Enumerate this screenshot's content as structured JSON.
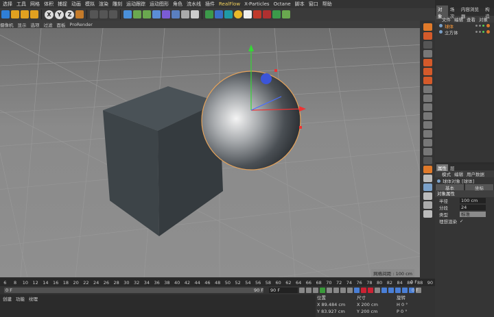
{
  "menubar": {
    "items": [
      "选择",
      "工具",
      "网格",
      "体积",
      "捕捉",
      "动画",
      "模拟",
      "渲染",
      "雕刻",
      "运动跟踪",
      "运动图形",
      "角色",
      "流水线",
      "插件",
      "RealFlow",
      "X-Particles",
      "Octane",
      "脚本",
      "窗口",
      "帮助"
    ]
  },
  "toolbar": {
    "axis_x": "X",
    "axis_y": "Y",
    "axis_z": "Z"
  },
  "viewport_menu": {
    "items": [
      "摄像机",
      "显示",
      "选项",
      "过滤",
      "面板",
      "ProRender"
    ],
    "grid_footer": "网格间距 : 100 cm"
  },
  "object_manager": {
    "tabs": [
      "对象",
      "场次",
      "内容浏览器",
      "构造"
    ],
    "menu": [
      "文件",
      "编辑",
      "查看",
      "对象"
    ],
    "objects": [
      {
        "name": "球体",
        "selected": true
      },
      {
        "name": "立方体",
        "selected": false
      }
    ]
  },
  "attributes": {
    "tabs": [
      "属性",
      "层"
    ],
    "menu": [
      "模式",
      "编辑",
      "用户数据"
    ],
    "object_title": "球体对象 [球体]",
    "subtabs": [
      "基本",
      "坐标"
    ],
    "section": "对象属性",
    "props": [
      {
        "label": "半径",
        "value": "100 cm",
        "highlight": false
      },
      {
        "label": "分段",
        "value": "24",
        "highlight": false
      },
      {
        "label": "类型",
        "value": "标准",
        "highlight": true
      },
      {
        "label": "理想渲染",
        "value": "✓",
        "highlight": false
      }
    ]
  },
  "timeline": {
    "ticks": [
      "6",
      "8",
      "10",
      "12",
      "14",
      "16",
      "18",
      "20",
      "22",
      "24",
      "26",
      "28",
      "30",
      "32",
      "34",
      "36",
      "38",
      "40",
      "42",
      "44",
      "46",
      "48",
      "50",
      "52",
      "54",
      "56",
      "58",
      "60",
      "62",
      "64",
      "66",
      "68",
      "70",
      "72",
      "74",
      "76",
      "78",
      "80",
      "82",
      "84",
      "86",
      "88",
      "90"
    ],
    "frame_end_label": "0 F",
    "start_field": "0 F",
    "slider_end": "90 F",
    "end_field": "90 F",
    "current_frame": "0 F"
  },
  "bottom_tabs": [
    "创建",
    "功能",
    "纹理"
  ],
  "coordinates": {
    "headers": [
      "位置",
      "尺寸",
      "旋转"
    ],
    "rows": [
      {
        "pos_axis": "X",
        "pos": "89.484 cm",
        "size_axis": "X",
        "size": "200 cm",
        "rot_axis": "H",
        "rot": "0 °"
      },
      {
        "pos_axis": "Y",
        "pos": "83.927 cm",
        "size_axis": "Y",
        "size": "200 cm",
        "rot_axis": "P",
        "rot": "0 °"
      }
    ]
  },
  "colors": {
    "accent": "#ff9c3a",
    "realflow": "#f4d35e",
    "viewport_top": "#6e6e6e"
  }
}
